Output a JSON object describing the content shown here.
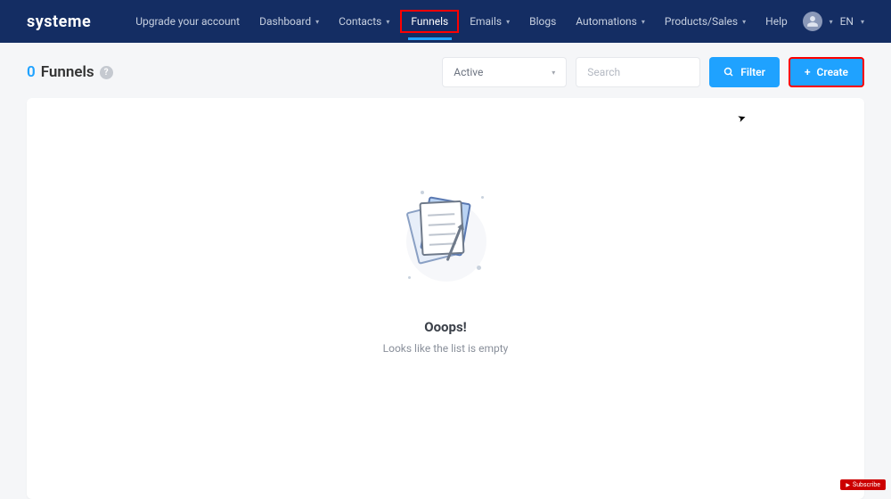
{
  "brand": "systeme",
  "nav": {
    "items": [
      {
        "label": "Upgrade your account",
        "dropdown": false
      },
      {
        "label": "Dashboard",
        "dropdown": true
      },
      {
        "label": "Contacts",
        "dropdown": true
      },
      {
        "label": "Funnels",
        "dropdown": false
      },
      {
        "label": "Emails",
        "dropdown": true
      },
      {
        "label": "Blogs",
        "dropdown": false
      },
      {
        "label": "Automations",
        "dropdown": true
      },
      {
        "label": "Products/Sales",
        "dropdown": true
      },
      {
        "label": "Help",
        "dropdown": false
      }
    ],
    "language": "EN"
  },
  "page": {
    "count": "0",
    "title": "Funnels",
    "help_symbol": "?"
  },
  "toolbar": {
    "status_filter": "Active",
    "search_placeholder": "Search",
    "filter_label": "Filter",
    "create_label": "Create",
    "plus_symbol": "+"
  },
  "empty": {
    "title": "Ooops!",
    "subtitle": "Looks like the list is empty"
  },
  "yt": {
    "label": "Subscribe"
  }
}
